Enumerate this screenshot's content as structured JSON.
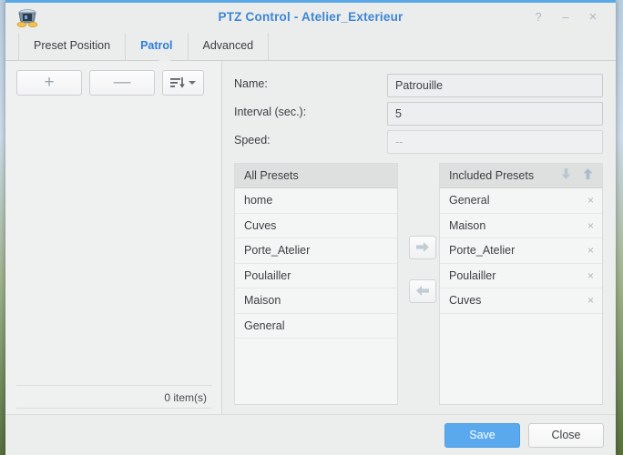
{
  "window": {
    "title": "PTZ Control - Atelier_Exterieur",
    "icon": "ptz-camera-icon",
    "accent_color": "#3c86d4",
    "controls": {
      "help": "?",
      "minimize": "–",
      "close": "×"
    }
  },
  "tabs": [
    {
      "label": "Preset Position",
      "active": false
    },
    {
      "label": "Patrol",
      "active": true
    },
    {
      "label": "Advanced",
      "active": false
    }
  ],
  "toolbar": {
    "add_label": "+",
    "remove_label": "—",
    "sort_icon": "sort-descending-icon",
    "sort_caret": "chevron-down-icon"
  },
  "left_panel": {
    "item_count_text": "0 item(s)"
  },
  "form": {
    "name": {
      "label": "Name:",
      "value": "Patrouille",
      "type": "text"
    },
    "interval": {
      "label": "Interval (sec.):",
      "value": "5",
      "type": "select"
    },
    "speed": {
      "label": "Speed:",
      "value": "--",
      "type": "select",
      "disabled": true
    }
  },
  "all_presets": {
    "header": "All Presets",
    "items": [
      {
        "label": "home"
      },
      {
        "label": "Cuves"
      },
      {
        "label": "Porte_Atelier"
      },
      {
        "label": "Poulailler"
      },
      {
        "label": "Maison"
      },
      {
        "label": "General"
      }
    ]
  },
  "included_presets": {
    "header": "Included Presets",
    "move_down_icon": "arrow-down-icon",
    "move_up_icon": "arrow-up-icon",
    "remove_glyph": "×",
    "items": [
      {
        "label": "General"
      },
      {
        "label": "Maison"
      },
      {
        "label": "Porte_Atelier"
      },
      {
        "label": "Poulailler"
      },
      {
        "label": "Cuves"
      }
    ]
  },
  "transfer": {
    "add_icon": "arrow-right-icon",
    "remove_icon": "arrow-left-icon"
  },
  "footer": {
    "save_label": "Save",
    "close_label": "Close",
    "save_color": "#5aa9ee"
  }
}
